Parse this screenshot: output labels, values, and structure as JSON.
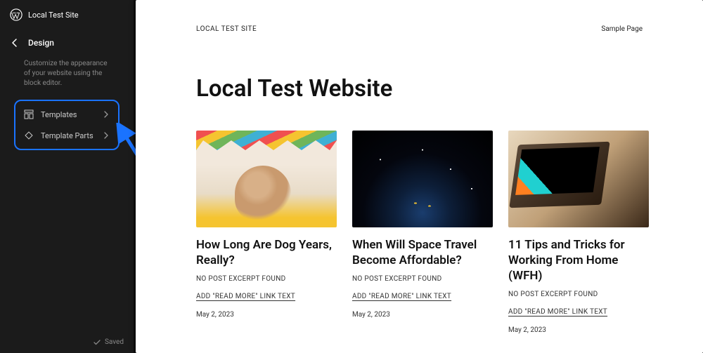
{
  "sidebar": {
    "site_name": "Local Test Site",
    "design_title": "Design",
    "design_description": "Customize the appearance of your website using the block editor.",
    "items": [
      {
        "label": "Templates",
        "icon": "layout-icon"
      },
      {
        "label": "Template Parts",
        "icon": "diamond-icon"
      }
    ],
    "status": "Saved"
  },
  "preview": {
    "brand": "LOCAL TEST SITE",
    "nav_link": "Sample Page",
    "title": "Local Test Website",
    "posts": [
      {
        "title": "How Long Are Dog Years, Really?",
        "excerpt": "NO POST EXCERPT FOUND",
        "more_link": "ADD \"READ MORE\" LINK TEXT",
        "date": "May 2, 2023"
      },
      {
        "title": "When Will Space Travel Become Affordable?",
        "excerpt": "NO POST EXCERPT FOUND",
        "more_link": "ADD \"READ MORE\" LINK TEXT",
        "date": "May 2, 2023"
      },
      {
        "title": "11 Tips and Tricks for Working From Home (WFH)",
        "excerpt": "NO POST EXCERPT FOUND",
        "more_link": "ADD \"READ MORE\" LINK TEXT",
        "date": "May 2, 2023"
      }
    ]
  },
  "colors": {
    "highlight": "#1a73ff"
  }
}
